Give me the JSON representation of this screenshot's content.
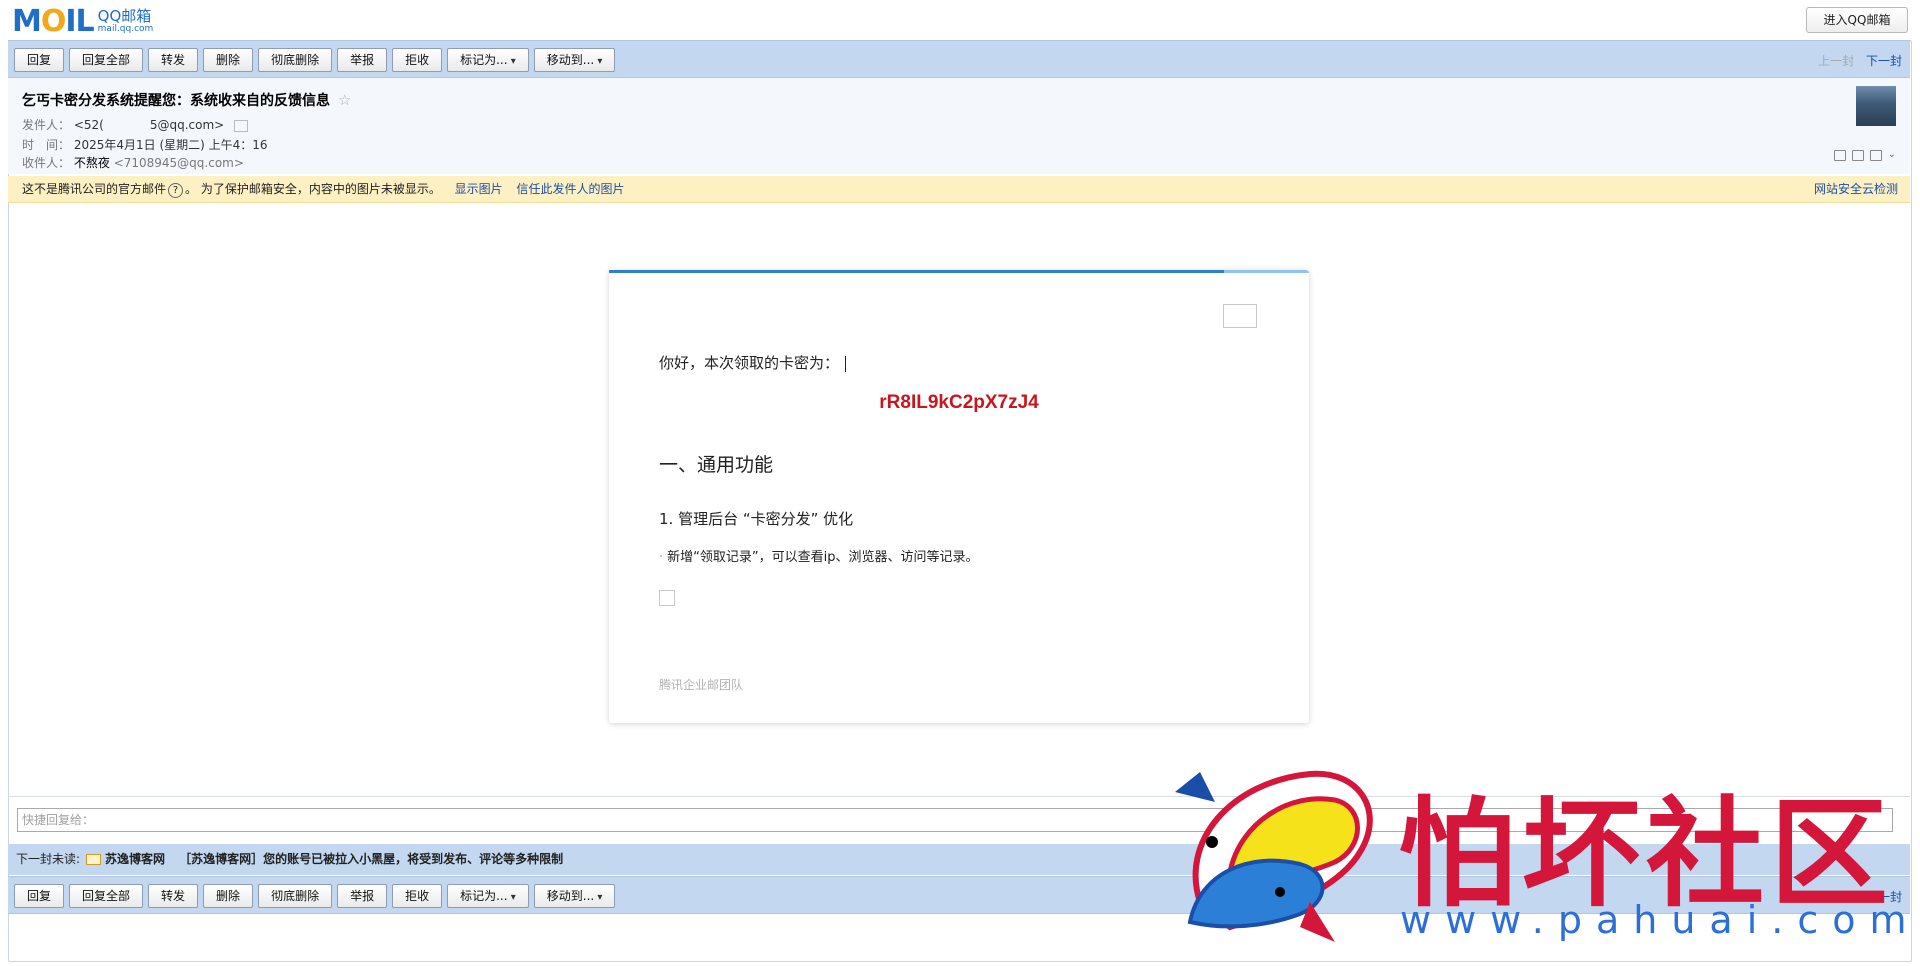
{
  "app": {
    "logo_word": "MOIL",
    "logo_brand": "QQ邮箱",
    "logo_domain": "mail.qq.com",
    "enter_button": "进入QQ邮箱"
  },
  "toolbar": {
    "buttons": [
      "回复",
      "回复全部",
      "转发",
      "删除",
      "彻底删除",
      "举报",
      "拒收",
      "标记为...",
      "移动到..."
    ],
    "prev": "上一封",
    "next": "下一封"
  },
  "mail": {
    "subject": "乞丐卡密分发系统提醒您：系统收来自的反馈信息",
    "star": "☆",
    "from_label": "发件人：",
    "from_value_a": "<52(",
    "from_value_b": "5@qq.com>",
    "time_label": "时　间：",
    "time_value": "2025年4月1日 (星期二) 上午4：16",
    "to_label": "收件人：",
    "to_name": "不熬夜",
    "to_email": "<7108945@qq.com>"
  },
  "warning": {
    "text_a": "这不是腾讯公司的官方邮件",
    "q": "?",
    "text_b": "。 为了保护邮箱安全，内容中的图片未被显示。",
    "show_images": "显示图片",
    "trust_images": "信任此发件人的图片",
    "security_check": "网站安全云检测"
  },
  "body": {
    "greeting": "你好，本次领取的卡密为：",
    "code": "rR8IL9kC2pX7zJ4",
    "section_title": "一、通用功能",
    "item_title": "1. 管理后台 “卡密分发” 优化",
    "item_dot": "·",
    "item_desc": "新增“领取记录”，可以查看ip、浏览器、访问等记录。",
    "team": "腾讯企业邮团队"
  },
  "quick_reply": {
    "placeholder": "快捷回复给："
  },
  "next_unread": {
    "label": "下一封未读:",
    "sender": "苏逸博客网",
    "subject": "［苏逸博客网］您的账号已被拉入小黑屋，将受到发布、评论等多种限制"
  },
  "watermark": {
    "text": "怕坏社区",
    "url": "www.pahuai.com"
  }
}
